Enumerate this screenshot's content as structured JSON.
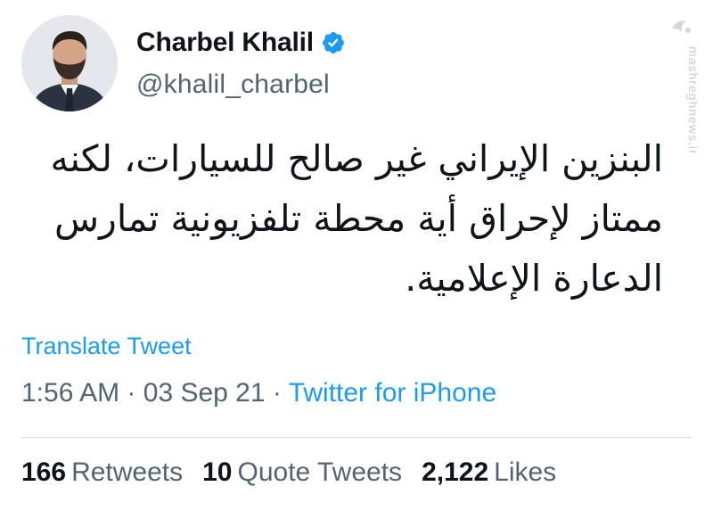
{
  "user": {
    "display_name": "Charbel Khalil",
    "handle": "@khalil_charbel"
  },
  "tweet": {
    "lines": [
      "البنزين الإيراني غير صالح للسيارات، لكنه",
      "ممتاز لإحراق أية محطة تلفزيونية تمارس",
      "الدعارة الإعلامية."
    ],
    "translate_label": "Translate Tweet",
    "time": "1:56 AM",
    "date": "03 Sep 21",
    "separator": "·",
    "source": "Twitter for iPhone"
  },
  "stats": {
    "retweets_count": "166",
    "retweets_label": "Retweets",
    "quotes_count": "10",
    "quotes_label": "Quote Tweets",
    "likes_count": "2,122",
    "likes_label": "Likes"
  },
  "watermark": {
    "text": "mashreghnews.ir"
  },
  "colors": {
    "accent": "#1d9bf0",
    "secondary_text": "#536471",
    "primary_text": "#0f1419"
  }
}
